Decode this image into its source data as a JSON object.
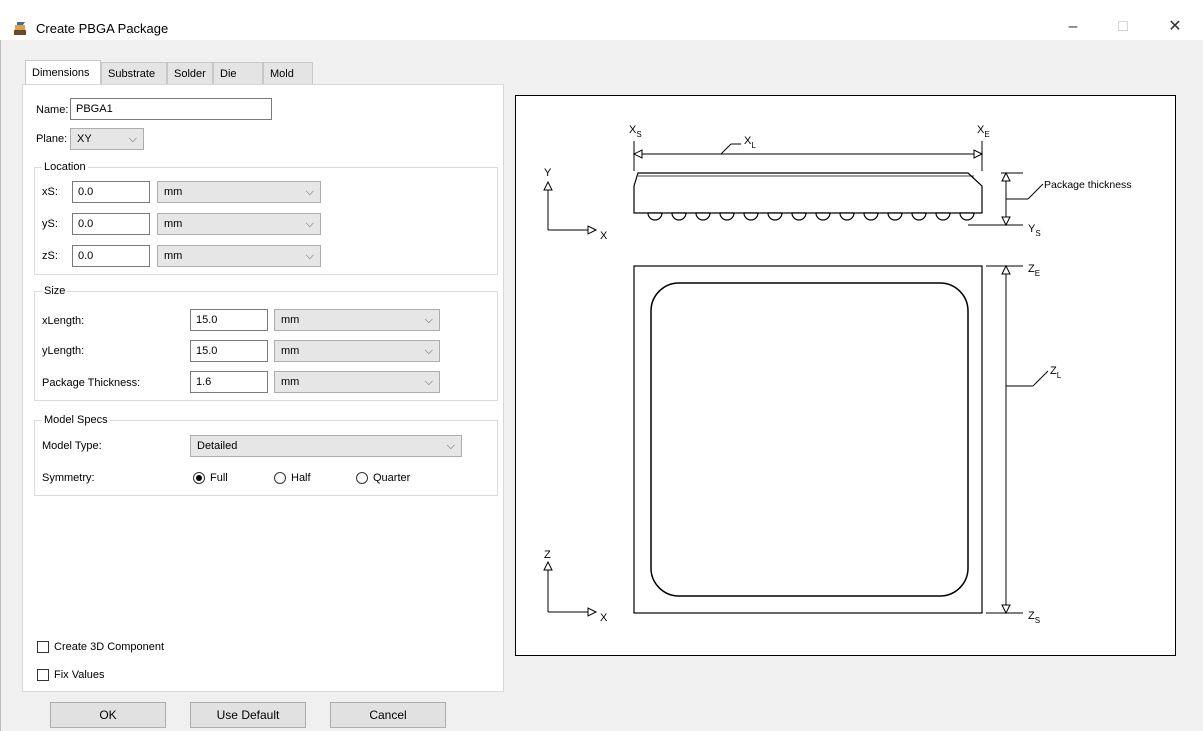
{
  "window": {
    "title": "Create PBGA Package",
    "minimize": "–",
    "maximize": "□",
    "close": "✕"
  },
  "tabs": [
    "Dimensions",
    "Substrate",
    "Solder",
    "Die",
    "Mold"
  ],
  "name": {
    "label": "Name:",
    "value": "PBGA1"
  },
  "plane": {
    "label": "Plane:",
    "value": "XY"
  },
  "location": {
    "title": "Location",
    "rows": [
      {
        "label": "xS:",
        "value": "0.0",
        "unit": "mm"
      },
      {
        "label": "yS:",
        "value": "0.0",
        "unit": "mm"
      },
      {
        "label": "zS:",
        "value": "0.0",
        "unit": "mm"
      }
    ]
  },
  "size": {
    "title": "Size",
    "rows": [
      {
        "label": "xLength:",
        "value": "15.0",
        "unit": "mm"
      },
      {
        "label": "yLength:",
        "value": "15.0",
        "unit": "mm"
      },
      {
        "label": "Package Thickness:",
        "value": "1.6",
        "unit": "mm"
      }
    ]
  },
  "model_specs": {
    "title": "Model Specs",
    "model_type_label": "Model Type:",
    "model_type_value": "Detailed",
    "symmetry_label": "Symmetry:",
    "symmetry_options": [
      "Full",
      "Half",
      "Quarter"
    ],
    "symmetry_selected": "Full"
  },
  "checkboxes": {
    "create_3d": {
      "label": "Create 3D Component",
      "checked": false
    },
    "fix_values": {
      "label": "Fix Values",
      "checked": false
    }
  },
  "buttons": {
    "ok": "OK",
    "use_default": "Use Default",
    "cancel": "Cancel"
  },
  "diagram": {
    "xs": "X",
    "xs_sub": "S",
    "xe": "X",
    "xe_sub": "E",
    "xl": "X",
    "xl_sub": "L",
    "y_axis": "Y",
    "x_axis": "X",
    "z_axis": "Z",
    "x_axis2": "X",
    "package_thickness": "Package thickness",
    "ys": "Y",
    "ys_sub": "S",
    "ze": "Z",
    "ze_sub": "E",
    "zl": "Z",
    "zl_sub": "L",
    "zs": "Z",
    "zs_sub": "S"
  },
  "colors": {
    "background": "#f0f0f0",
    "panel": "#ffffff",
    "button": "#e1e1e1",
    "select": "#e6e6e6"
  }
}
